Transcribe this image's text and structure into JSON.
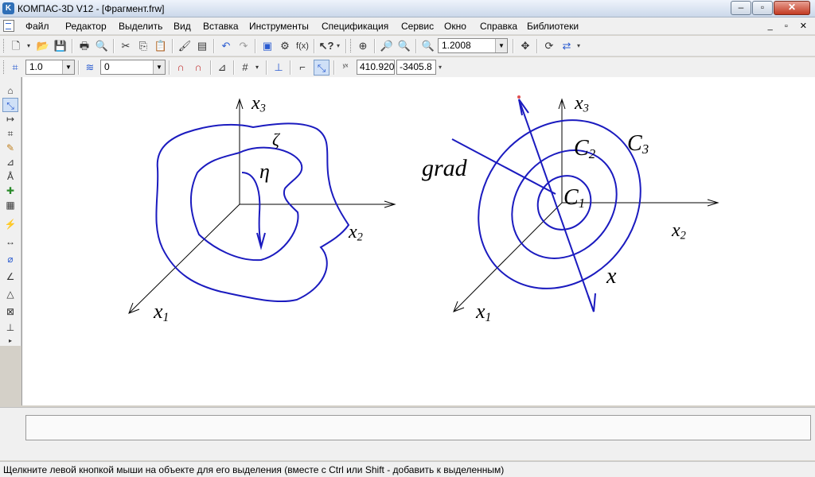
{
  "window": {
    "title": "КОМПАС-3D V12 - [Фрагмент.frw]",
    "app_icon": "K",
    "minimize": "–",
    "maximize": "▫",
    "close": "✕"
  },
  "menu": {
    "items": [
      "Файл",
      "Редактор",
      "Выделить",
      "Вид",
      "Вставка",
      "Инструменты",
      "Спецификация",
      "Сервис",
      "Окно",
      "Справка",
      "Библиотеки"
    ],
    "mdi_buttons": "_ ▫ ✕"
  },
  "toolbar": {
    "zoom_value": "1.2008",
    "style_value": "1.0",
    "layer_value": "0",
    "coord_x": "410.920",
    "coord_y": "-3405.8"
  },
  "drawing": {
    "left_figure": {
      "x3_label": {
        "main": "x",
        "sub": "3"
      },
      "x2_label": {
        "main": "x",
        "sub": "2"
      },
      "x1_label": {
        "main": "x",
        "sub": "1"
      },
      "zeta": "ζ",
      "eta": "η"
    },
    "right_figure": {
      "x3_label": {
        "main": "x",
        "sub": "3"
      },
      "x2_label": {
        "main": "x",
        "sub": "2"
      },
      "x1_label": {
        "main": "x",
        "sub": "1"
      },
      "grad": "grad",
      "c1": {
        "main": "C",
        "sub": "1"
      },
      "c2": {
        "main": "C",
        "sub": "2"
      },
      "c3": {
        "main": "C",
        "sub": "3"
      },
      "x_label": "x"
    }
  },
  "status": {
    "text": "Щелкните левой кнопкой мыши на объекте для его выделения (вместе с Ctrl или Shift - добавить к выделенным)"
  },
  "colors": {
    "curve": "#1b1bbf",
    "axis": "#000000",
    "accent_point": "#e05050"
  }
}
